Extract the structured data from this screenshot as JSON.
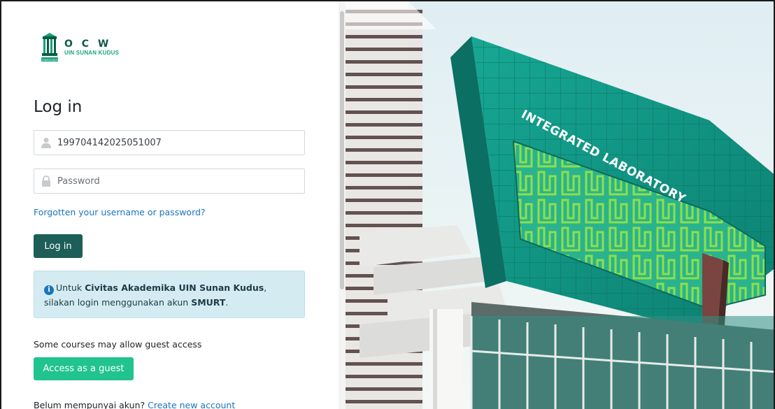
{
  "logo": {
    "title": "O C W",
    "subtitle": "UIN SUNAN KUDUS",
    "mark_caption": "SUNAN KUDUS",
    "icon": "university-crest-icon"
  },
  "login": {
    "heading": "Log in",
    "username": {
      "value": "199704142025051007",
      "icon": "user-icon"
    },
    "password": {
      "placeholder": "Password",
      "icon": "lock-icon"
    },
    "forgot_link": "Forgotten your username or password?",
    "submit_label": "Log in"
  },
  "info": {
    "icon": "info-icon",
    "part1": "Untuk ",
    "bold1": "Civitas Akademika UIN Sunan Kudus",
    "part2": ", silakan login menggunakan akun ",
    "bold2": "SMURT",
    "part3": "."
  },
  "guest": {
    "label": "Some courses may allow guest access",
    "button_label": "Access as a guest"
  },
  "signup": {
    "text": "Belum mempunyai akun? ",
    "link": "Create new account"
  },
  "photo": {
    "sign_text": "INTEGRATED LABORATORY"
  },
  "colors": {
    "primary_button": "#1d5e59",
    "guest_button": "#21c38f",
    "link": "#1b75bb",
    "info_bg": "#d4ecf1",
    "brand_green": "#0e5a48"
  }
}
